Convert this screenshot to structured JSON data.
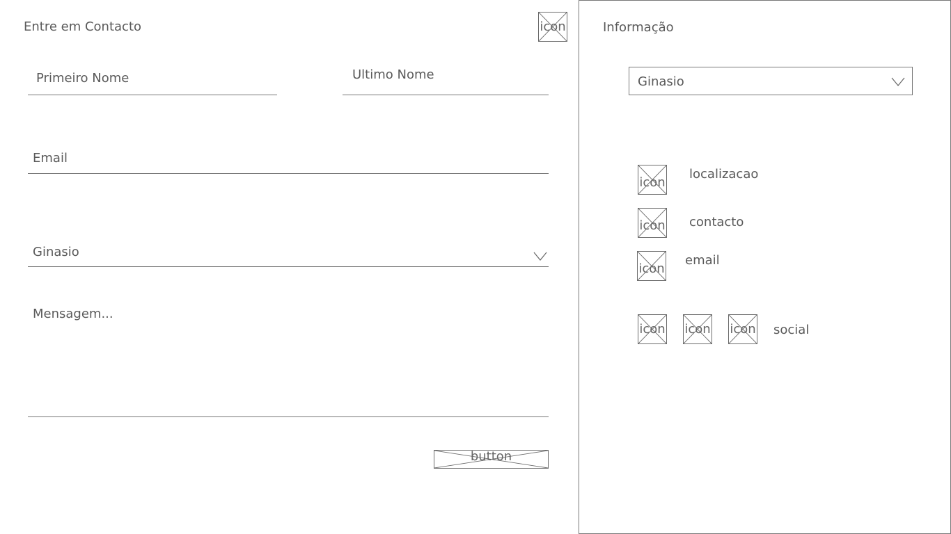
{
  "form": {
    "title": "Entre em Contacto",
    "header_icon_label": "icon",
    "first_name": {
      "placeholder": "Primeiro Nome"
    },
    "last_name": {
      "placeholder": "Ultimo Nome"
    },
    "email": {
      "placeholder": "Email"
    },
    "gym_select": {
      "value": "Ginasio"
    },
    "message": {
      "placeholder": "Mensagem..."
    },
    "submit_label": "button"
  },
  "info": {
    "title": "Informação",
    "gym_select": {
      "value": "Ginasio"
    },
    "items": [
      {
        "icon_label": "icon",
        "label": "localizacao",
        "icon": "location-icon"
      },
      {
        "icon_label": "icon",
        "label": "contacto",
        "icon": "phone-icon"
      },
      {
        "icon_label": "icon",
        "label": "email",
        "icon": "email-icon"
      }
    ],
    "social": {
      "label": "social",
      "icons": [
        {
          "icon_label": "icon",
          "icon": "social-icon-1"
        },
        {
          "icon_label": "icon",
          "icon": "social-icon-2"
        },
        {
          "icon_label": "icon",
          "icon": "social-icon-3"
        }
      ]
    }
  }
}
